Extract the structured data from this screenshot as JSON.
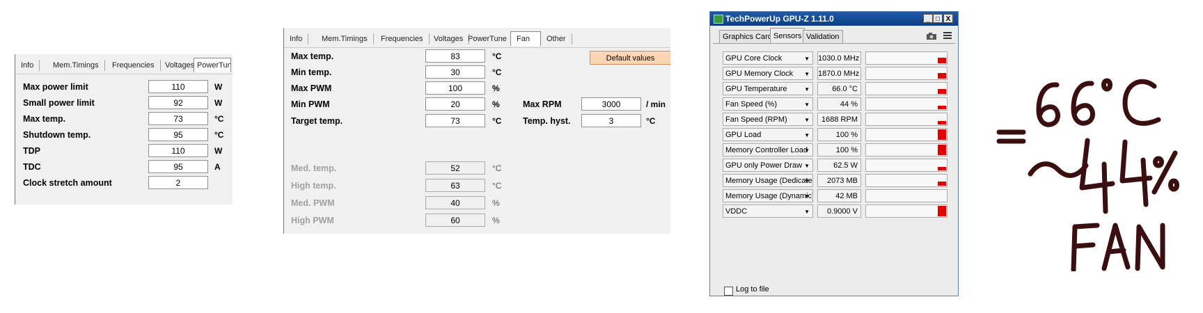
{
  "powertune_panel": {
    "tabs": [
      "Info",
      "Mem.Timings",
      "Frequencies",
      "Voltages",
      "PowerTune"
    ],
    "rows": [
      {
        "label": "Max power limit",
        "value": "110",
        "unit": "W"
      },
      {
        "label": "Small power limit",
        "value": "92",
        "unit": "W"
      },
      {
        "label": "Max temp.",
        "value": "73",
        "unit": "°C"
      },
      {
        "label": "Shutdown temp.",
        "value": "95",
        "unit": "°C"
      },
      {
        "label": "TDP",
        "value": "110",
        "unit": "W"
      },
      {
        "label": "TDC",
        "value": "95",
        "unit": "A"
      },
      {
        "label": "Clock stretch amount",
        "value": "2",
        "unit": ""
      }
    ]
  },
  "fan_panel": {
    "tabs": [
      "Info",
      "Mem.Timings",
      "Frequencies",
      "Voltages",
      "PowerTune",
      "Fan",
      "Other"
    ],
    "default_button": "Default values",
    "rows": [
      {
        "label": "Max temp.",
        "value": "83",
        "unit": "°C"
      },
      {
        "label": "Min temp.",
        "value": "30",
        "unit": "°C"
      },
      {
        "label": "Max PWM",
        "value": "100",
        "unit": "%"
      },
      {
        "label": "Min PWM",
        "value": "20",
        "unit": "%"
      },
      {
        "label": "Target temp.",
        "value": "73",
        "unit": "°C"
      }
    ],
    "right_rows": [
      {
        "label": "Max RPM",
        "value": "3000",
        "unit": "/ min"
      },
      {
        "label": "Temp. hyst.",
        "value": "3",
        "unit": "°C"
      }
    ],
    "readonly_rows": [
      {
        "label": "Med. temp.",
        "value": "52",
        "unit": "°C"
      },
      {
        "label": "High temp.",
        "value": "63",
        "unit": "°C"
      },
      {
        "label": "Med. PWM",
        "value": "40",
        "unit": "%"
      },
      {
        "label": "High PWM",
        "value": "60",
        "unit": "%"
      }
    ]
  },
  "gpuz": {
    "title": "TechPowerUp GPU-Z 1.11.0",
    "window_buttons": [
      "_",
      "□",
      "X"
    ],
    "tabs": [
      "Graphics Card",
      "Sensors",
      "Validation"
    ],
    "camera_icon": "camera-icon",
    "menu_icon": "menu-icon",
    "sensors": [
      {
        "name": "GPU Core Clock",
        "value": "1030.0 MHz",
        "level": 0.5
      },
      {
        "name": "GPU Memory Clock",
        "value": "1870.0 MHz",
        "level": 0.5
      },
      {
        "name": "GPU Temperature",
        "value": "66.0 °C",
        "level": 0.45
      },
      {
        "name": "Fan Speed (%)",
        "value": "44 %",
        "level": 0.3
      },
      {
        "name": "Fan Speed (RPM)",
        "value": "1688 RPM",
        "level": 0.3
      },
      {
        "name": "GPU Load",
        "value": "100 %",
        "level": 1.0
      },
      {
        "name": "Memory Controller Load",
        "value": "100 %",
        "level": 1.0
      },
      {
        "name": "GPU only Power Draw",
        "value": "62.5 W",
        "level": 0.3
      },
      {
        "name": "Memory Usage (Dedicated)",
        "value": "2073 MB",
        "level": 0.4
      },
      {
        "name": "Memory Usage (Dynamic)",
        "value": "42 MB",
        "level": 0
      },
      {
        "name": "VDDC",
        "value": "0.9000 V",
        "level": 1.0
      }
    ],
    "log_to_file": "Log to file"
  },
  "handwritten": {
    "equals": "=",
    "line1": "66°C",
    "tilde": "~",
    "line2": "44%",
    "line3": "FAN"
  }
}
